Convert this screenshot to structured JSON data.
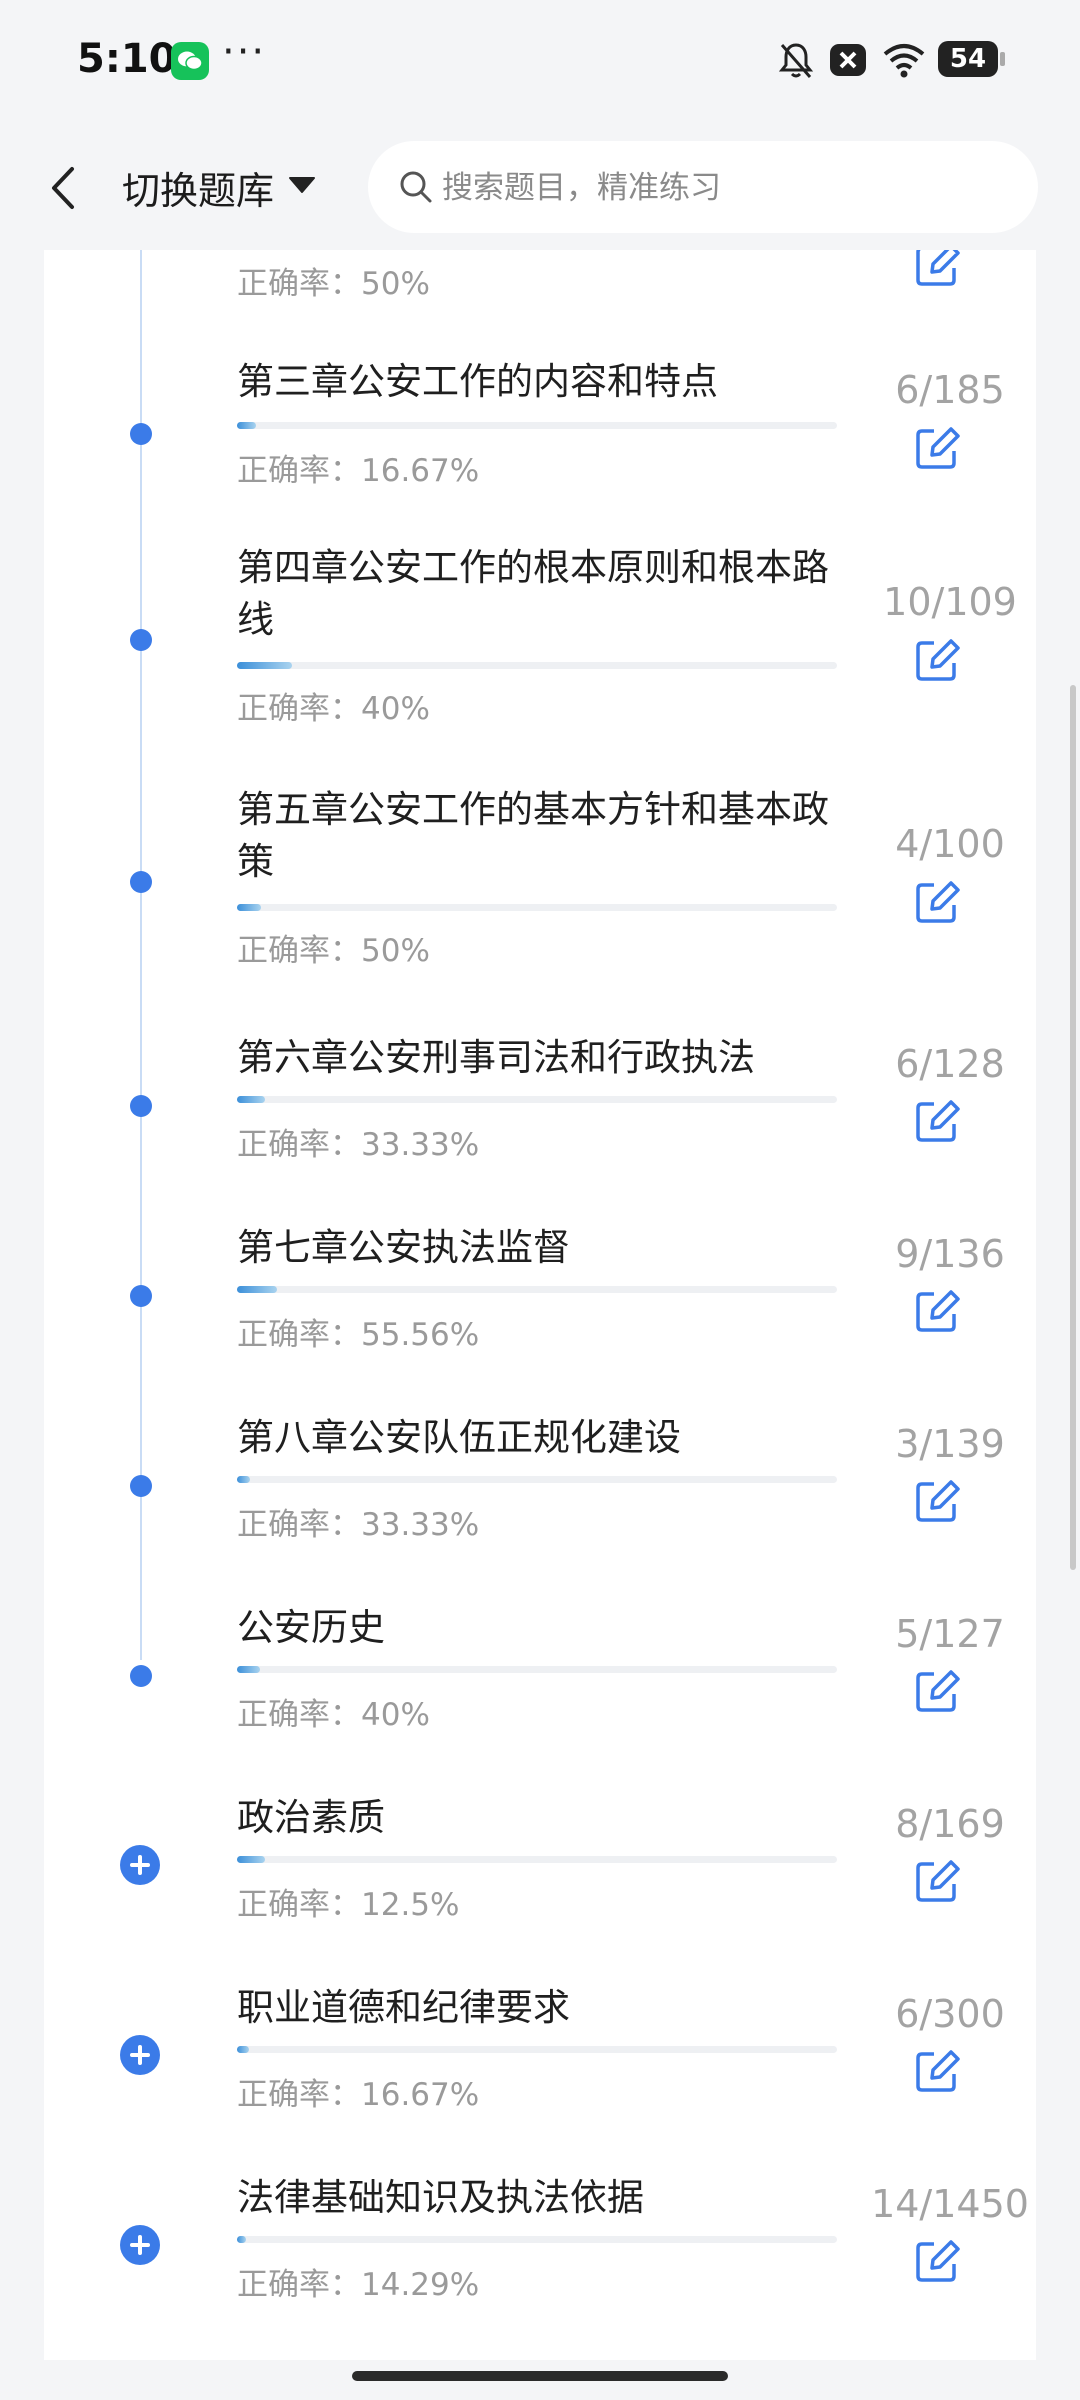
{
  "status_bar": {
    "time": "5:10",
    "dots": "···",
    "battery": "54",
    "icons": [
      "wechat-icon",
      "mute-bell-icon",
      "close-box-icon",
      "wifi-icon",
      "battery-icon"
    ]
  },
  "header": {
    "back_icon": "chevron-left-icon",
    "title": "切换题库",
    "caret_icon": "caret-down-icon",
    "search_placeholder": "搜索题目，精准练习"
  },
  "chapters": [
    {
      "title": "",
      "accuracy": "正确率：50%",
      "count": "",
      "progress": 0.0,
      "marker": "none"
    },
    {
      "title": "第三章公安工作的内容和特点",
      "accuracy": "正确率：16.67%",
      "count": "6/185",
      "progress": 0.032,
      "marker": "dot"
    },
    {
      "title": "第四章公安工作的根本原则和根本路线",
      "accuracy": "正确率：40%",
      "count": "10/109",
      "progress": 0.092,
      "marker": "dot"
    },
    {
      "title": "第五章公安工作的基本方针和基本政策",
      "accuracy": "正确率：50%",
      "count": "4/100",
      "progress": 0.04,
      "marker": "dot"
    },
    {
      "title": "第六章公安刑事司法和行政执法",
      "accuracy": "正确率：33.33%",
      "count": "6/128",
      "progress": 0.047,
      "marker": "dot"
    },
    {
      "title": "第七章公安执法监督",
      "accuracy": "正确率：55.56%",
      "count": "9/136",
      "progress": 0.066,
      "marker": "dot"
    },
    {
      "title": "第八章公安队伍正规化建设",
      "accuracy": "正确率：33.33%",
      "count": "3/139",
      "progress": 0.022,
      "marker": "dot"
    },
    {
      "title": "公安历史",
      "accuracy": "正确率：40%",
      "count": "5/127",
      "progress": 0.039,
      "marker": "dot"
    },
    {
      "title": "政治素质",
      "accuracy": "正确率：12.5%",
      "count": "8/169",
      "progress": 0.047,
      "marker": "plus"
    },
    {
      "title": "职业道德和纪律要求",
      "accuracy": "正确率：16.67%",
      "count": "6/300",
      "progress": 0.02,
      "marker": "plus"
    },
    {
      "title": "法律基础知识及执法依据",
      "accuracy": "正确率：14.29%",
      "count": "14/1450",
      "progress": 0.01,
      "marker": "plus"
    }
  ],
  "colors": {
    "accent": "#3b7be8",
    "progress_start": "#3b8fd9",
    "progress_end": "#a9d3ef",
    "muted_text": "#9a9a9a"
  }
}
